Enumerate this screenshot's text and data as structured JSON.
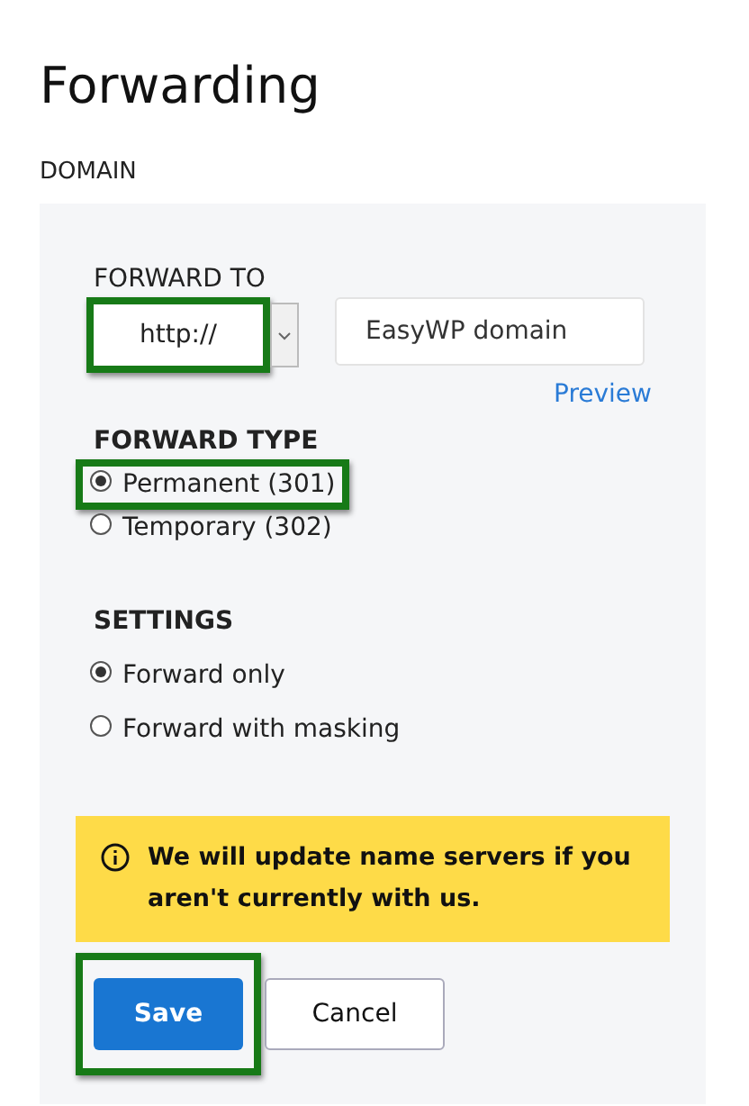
{
  "title": "Forwarding",
  "section": "DOMAIN",
  "forward_to": {
    "label": "FORWARD TO",
    "protocol": "http://",
    "protocol_highlighted": true,
    "domain_value": "EasyWP domain",
    "preview_link": "Preview"
  },
  "forward_type": {
    "label": "FORWARD TYPE",
    "options": [
      {
        "label": "Permanent (301)",
        "selected": true,
        "highlighted": true
      },
      {
        "label": "Temporary (302)",
        "selected": false,
        "highlighted": false
      }
    ]
  },
  "settings": {
    "label": "SETTINGS",
    "options": [
      {
        "label": "Forward only",
        "selected": true,
        "highlighted": false
      },
      {
        "label": "Forward with masking",
        "selected": false,
        "highlighted": false
      }
    ]
  },
  "notice": "We will update name servers if you aren't currently with us.",
  "buttons": [
    {
      "label": "Save",
      "kind": "primary",
      "highlighted": true
    },
    {
      "label": "Cancel",
      "kind": "secondary",
      "highlighted": false
    }
  ]
}
